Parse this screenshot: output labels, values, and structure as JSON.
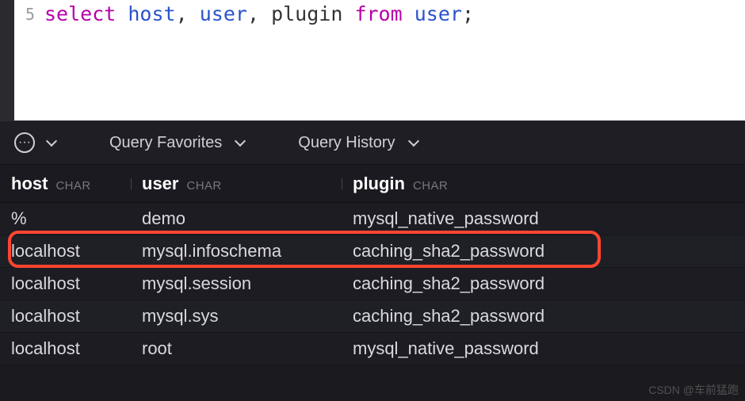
{
  "editor": {
    "line_number": "5",
    "tokens": {
      "select": "select",
      "host": "host",
      "comma1": ",",
      "user": "user",
      "comma2": ",",
      "plugin_ident": "plugin",
      "from": "from",
      "table": "user",
      "semi": ";"
    }
  },
  "toolbar": {
    "favorites_label": "Query Favorites",
    "history_label": "Query History"
  },
  "columns": {
    "host": {
      "name": "host",
      "type": "CHAR"
    },
    "user": {
      "name": "user",
      "type": "CHAR"
    },
    "plugin": {
      "name": "plugin",
      "type": "CHAR"
    }
  },
  "chart_data": {
    "type": "table",
    "columns": [
      "host",
      "user",
      "plugin"
    ],
    "rows": [
      {
        "host": "%",
        "user": "demo",
        "plugin": "mysql_native_password",
        "highlighted": true
      },
      {
        "host": "localhost",
        "user": "mysql.infoschema",
        "plugin": "caching_sha2_password"
      },
      {
        "host": "localhost",
        "user": "mysql.session",
        "plugin": "caching_sha2_password"
      },
      {
        "host": "localhost",
        "user": "mysql.sys",
        "plugin": "caching_sha2_password"
      },
      {
        "host": "localhost",
        "user": "root",
        "plugin": "mysql_native_password"
      }
    ]
  },
  "watermark": "CSDN @车前猛跑"
}
